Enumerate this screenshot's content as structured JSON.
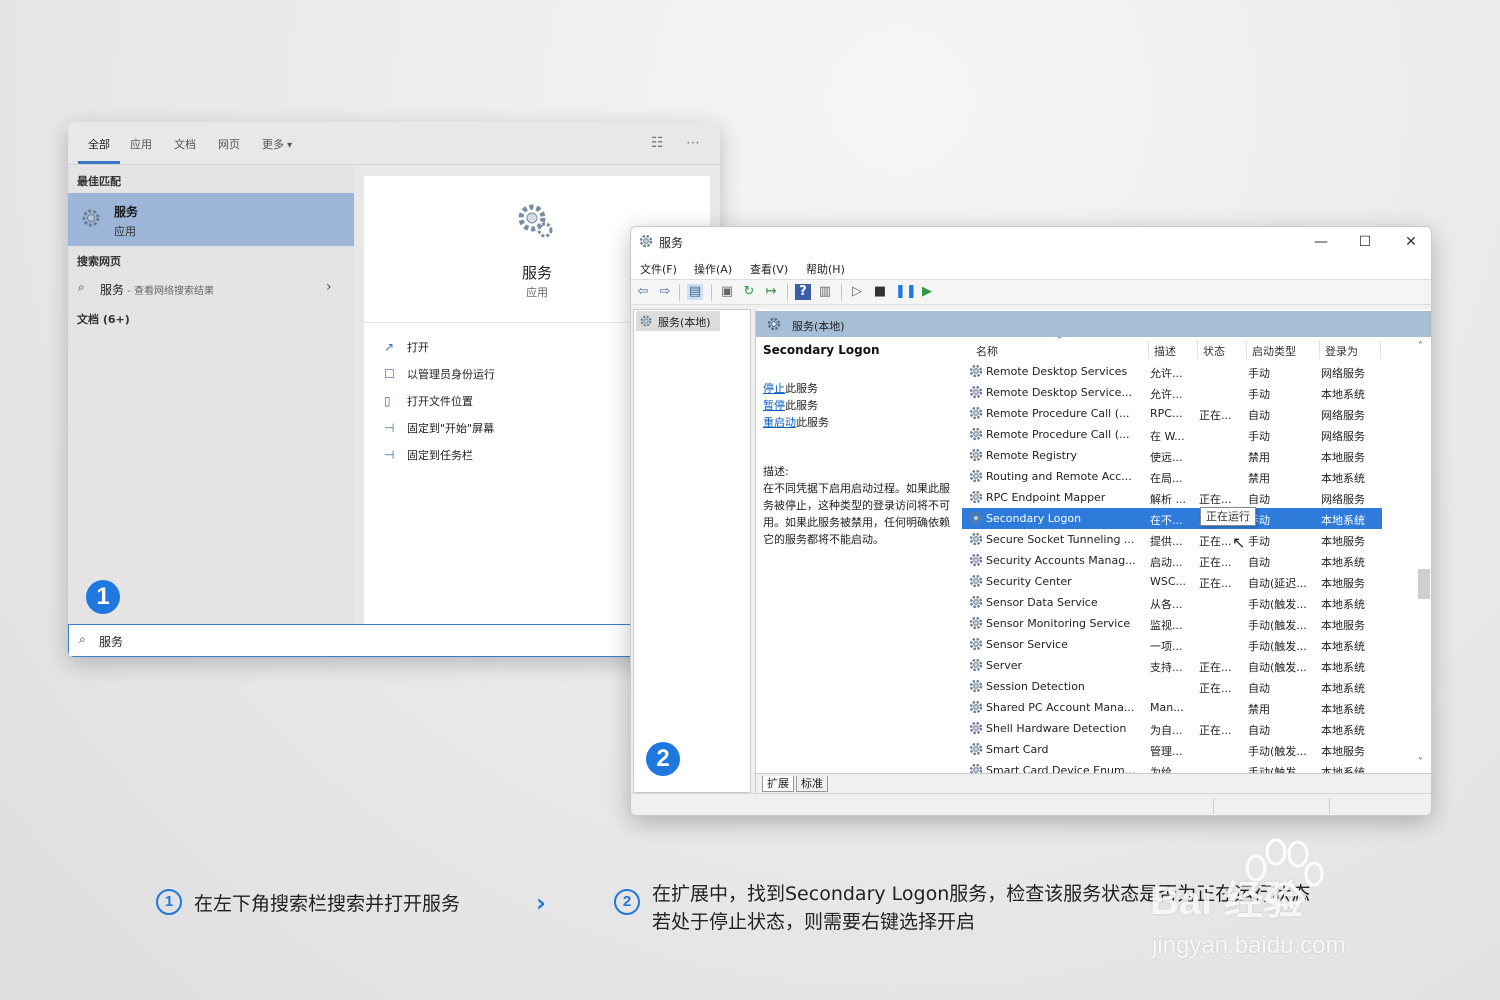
{
  "search_panel": {
    "tabs": [
      "全部",
      "应用",
      "文档",
      "网页",
      "更多"
    ],
    "best_match_label": "最佳匹配",
    "best_match": {
      "title": "服务",
      "subtitle": "应用"
    },
    "web_label": "搜索网页",
    "web_result": {
      "title": "服务",
      "suffix": " - 查看网络搜索结果"
    },
    "docs_label": "文档 (6+)",
    "preview": {
      "title": "服务",
      "subtitle": "应用"
    },
    "actions": [
      "打开",
      "以管理员身份运行",
      "打开文件位置",
      "固定到\"开始\"屏幕",
      "固定到任务栏"
    ],
    "search_value": "服务"
  },
  "badges": {
    "step1": "1",
    "step2": "2"
  },
  "services_window": {
    "title": "服务",
    "menu": [
      "文件(F)",
      "操作(A)",
      "查看(V)",
      "帮助(H)"
    ],
    "tree_item": "服务(本地)",
    "header_title": "服务(本地)",
    "detail": {
      "name": "Secondary Logon",
      "links": [
        {
          "link": "停止",
          "rest": "此服务"
        },
        {
          "link": "暂停",
          "rest": "此服务"
        },
        {
          "link": "重启动",
          "rest": "此服务"
        }
      ],
      "desc_label": "描述:",
      "desc": "在不同凭据下启用启动过程。如果此服务被停止，这种类型的登录访问将不可用。如果此服务被禁用，任何明确依赖它的服务都将不能启动。"
    },
    "columns": [
      "名称",
      "描述",
      "状态",
      "启动类型",
      "登录为"
    ],
    "rows": [
      [
        "Remote Desktop Services",
        "允许...",
        "",
        "手动",
        "网络服务"
      ],
      [
        "Remote Desktop Service...",
        "允许...",
        "",
        "手动",
        "本地系统"
      ],
      [
        "Remote Procedure Call (...",
        "RPC...",
        "正在...",
        "自动",
        "网络服务"
      ],
      [
        "Remote Procedure Call (...",
        "在 W...",
        "",
        "手动",
        "网络服务"
      ],
      [
        "Remote Registry",
        "使远...",
        "",
        "禁用",
        "本地服务"
      ],
      [
        "Routing and Remote Acc...",
        "在局...",
        "",
        "禁用",
        "本地系统"
      ],
      [
        "RPC Endpoint Mapper",
        "解析 ...",
        "正在...",
        "自动",
        "网络服务"
      ],
      [
        "Secondary Logon",
        "在不...",
        "正在运行",
        "手动",
        "本地系统"
      ],
      [
        "Secure Socket Tunneling ...",
        "提供...",
        "正在...",
        "手动",
        "本地服务"
      ],
      [
        "Security Accounts Manag...",
        "启动...",
        "正在...",
        "自动",
        "本地系统"
      ],
      [
        "Security Center",
        "WSC...",
        "正在...",
        "自动(延迟...",
        "本地服务"
      ],
      [
        "Sensor Data Service",
        "从各...",
        "",
        "手动(触发...",
        "本地系统"
      ],
      [
        "Sensor Monitoring Service",
        "监视...",
        "",
        "手动(触发...",
        "本地服务"
      ],
      [
        "Sensor Service",
        "一项...",
        "",
        "手动(触发...",
        "本地系统"
      ],
      [
        "Server",
        "支持...",
        "正在...",
        "自动(触发...",
        "本地系统"
      ],
      [
        "Session Detection",
        "",
        "正在...",
        "自动",
        "本地系统"
      ],
      [
        "Shared PC Account Mana...",
        "Man...",
        "",
        "禁用",
        "本地系统"
      ],
      [
        "Shell Hardware Detection",
        "为自...",
        "正在...",
        "自动",
        "本地系统"
      ],
      [
        "Smart Card",
        "管理...",
        "",
        "手动(触发...",
        "本地服务"
      ],
      [
        "Smart Card Device Enum...",
        "为给...",
        "",
        "手动(触发...",
        "本地系统"
      ]
    ],
    "selected_row": "Secondary Logon",
    "tooltip": "正在运行",
    "bottom_tabs": [
      "扩展",
      "标准"
    ]
  },
  "captions": {
    "step1_num": "1",
    "step1_text": "在左下角搜索栏搜索并打开服务",
    "step2_num": "2",
    "step2_line1": "在扩展中，找到Secondary Logon服务，检查该服务状态是否为正在运行状态",
    "step2_line2": "若处于停止状态，则需要右键选择开启"
  },
  "watermark": {
    "logo": "Bai 经验",
    "url": "jingyan.baidu.com"
  },
  "colors": {
    "accent": "#1f77e0",
    "selection": "#2e7bdc",
    "best_match_bg": "#9cb5d8",
    "header_bg": "#a7bed7"
  }
}
